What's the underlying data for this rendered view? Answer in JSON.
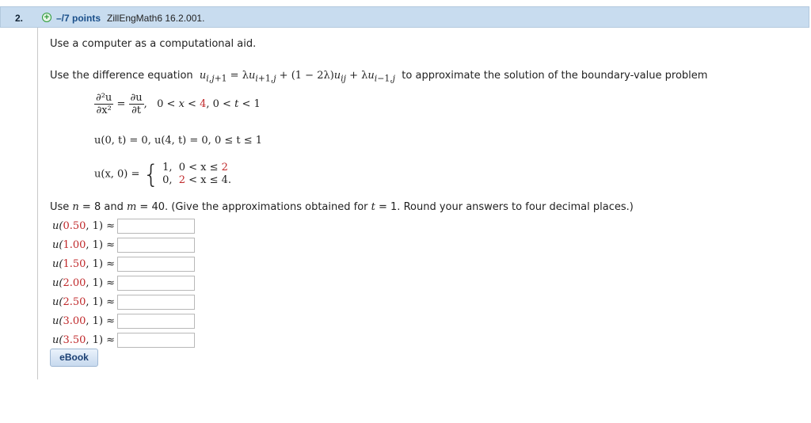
{
  "header": {
    "question_number": "2.",
    "plus_symbol": "+",
    "points": "–/7 points",
    "source": "ZillEngMath6 16.2.001."
  },
  "intro": "Use a computer as a computational aid.",
  "statement": {
    "prefix": "Use the difference equation",
    "suffix": "to approximate the solution of the boundary-value problem"
  },
  "pde": {
    "d2u": "∂²u",
    "dx2": "∂x²",
    "eq": "=",
    "du": "∂u",
    "dt": "∂t",
    "domain_a": "0 < ",
    "domain_x": "x",
    "domain_b": " < ",
    "domain_4": "4",
    "domain_c": ", 0 < ",
    "domain_t": "t",
    "domain_d": " < 1"
  },
  "boundary": "u(0, t) = 0,  u(4, t) = 0, 0 ≤ t ≤ 1",
  "initial": {
    "lhs": "u(x, 0) =",
    "case1_val": "1,",
    "case1_cond_pre": "0 < x ≤ ",
    "case1_cond_red": "2",
    "case2_val": "0,",
    "case2_cond_red": "2",
    "case2_cond_post": " < x ≤ 4."
  },
  "instruction": {
    "pre": "Use ",
    "n": "n",
    "mid1": " = 8 and ",
    "m": "m",
    "mid2": " = 40. (Give the approximations obtained for ",
    "t": "t",
    "post": " = 1. Round your answers to four decimal places.)"
  },
  "answers": [
    {
      "u": "u(",
      "x": "0.50",
      "rest": ", 1) ≈",
      "value": ""
    },
    {
      "u": "u(",
      "x": "1.00",
      "rest": ", 1) ≈",
      "value": ""
    },
    {
      "u": "u(",
      "x": "1.50",
      "rest": ", 1) ≈",
      "value": ""
    },
    {
      "u": "u(",
      "x": "2.00",
      "rest": ", 1) ≈",
      "value": ""
    },
    {
      "u": "u(",
      "x": "2.50",
      "rest": ", 1) ≈",
      "value": ""
    },
    {
      "u": "u(",
      "x": "3.00",
      "rest": ", 1) ≈",
      "value": ""
    },
    {
      "u": "u(",
      "x": "3.50",
      "rest": ", 1) ≈",
      "value": ""
    }
  ],
  "ebook_label": "eBook"
}
